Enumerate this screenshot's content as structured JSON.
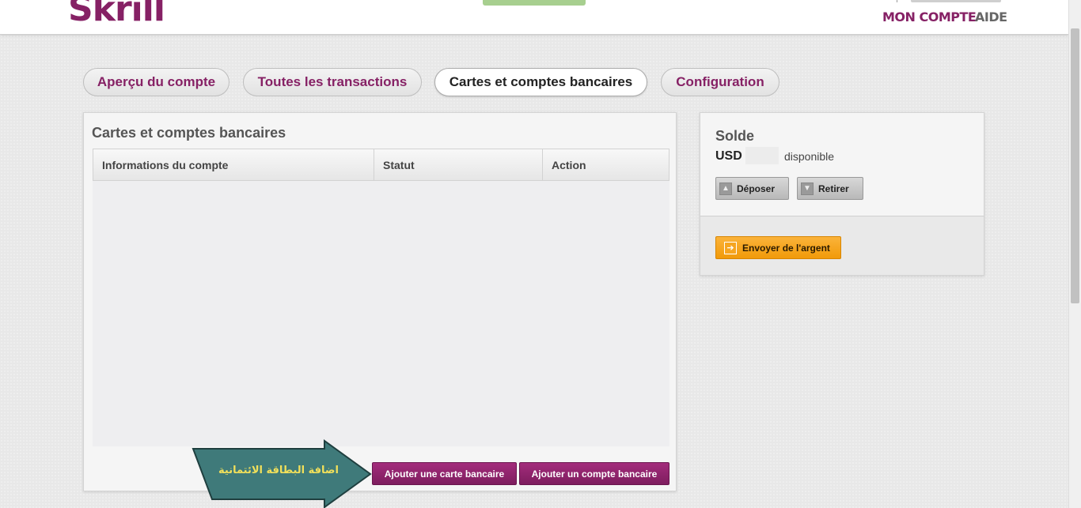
{
  "header": {
    "logo": "Skrill",
    "nav": {
      "mon_compte": "MON COMPTE",
      "aide": "AIDE"
    }
  },
  "tabs": [
    {
      "label": "Aperçu du compte",
      "active": false
    },
    {
      "label": "Toutes les transactions",
      "active": false
    },
    {
      "label": "Cartes et comptes bancaires",
      "active": true
    },
    {
      "label": "Configuration",
      "active": false
    }
  ],
  "main": {
    "title": "Cartes et comptes bancaires",
    "columns": [
      "Informations du compte",
      "Statut",
      "Action"
    ],
    "add_card_label": "Ajouter une carte bancaire",
    "add_account_label": "Ajouter un compte bancaire"
  },
  "side": {
    "title": "Solde",
    "currency": "USD",
    "available_label": "disponible",
    "deposit_label": "Déposer",
    "withdraw_label": "Retirer",
    "send_label": "Envoyer de l'argent"
  },
  "annotation": {
    "text": "اضافة البطاقة الائتمانية"
  },
  "colors": {
    "brand": "#862165",
    "orange": "#f19a09",
    "annotation_arrow": "#3f7a7a",
    "annotation_text": "#f2e05a"
  }
}
